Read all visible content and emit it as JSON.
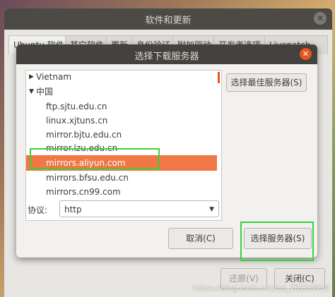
{
  "background_window": {
    "title": "软件和更新",
    "tabs": [
      "Ubuntu 软件",
      "其它软件",
      "更新",
      "身份验证",
      "附加驱动",
      "开发者选项",
      "Livepatch"
    ],
    "revert_button": "还原(V)",
    "close_button": "关闭(C)"
  },
  "dialog": {
    "title": "选择下载服务器",
    "tree": [
      {
        "label": "Vietnam",
        "level": 0,
        "expanded": false
      },
      {
        "label": "中国",
        "level": 0,
        "expanded": true
      },
      {
        "label": "ftp.sjtu.edu.cn",
        "level": 1
      },
      {
        "label": "linux.xjtuns.cn",
        "level": 1
      },
      {
        "label": "mirror.bjtu.edu.cn",
        "level": 1
      },
      {
        "label": "mirror.lzu.edu.cn",
        "level": 1
      },
      {
        "label": "mirrors.aliyun.com",
        "level": 1,
        "selected": true
      },
      {
        "label": "mirrors.bfsu.edu.cn",
        "level": 1
      },
      {
        "label": "mirrors.cn99.com",
        "level": 1
      }
    ],
    "best_server_button": "选择最佳服务器(S)",
    "protocol_label": "协议:",
    "protocol_value": "http",
    "cancel_button": "取消(C)",
    "choose_button": "选择服务器(S)"
  },
  "watermark": "https://blog.csdn.net/qq_20223919",
  "colors": {
    "accent": "#e95420",
    "selection": "#f07746",
    "highlight": "#39d13a"
  }
}
